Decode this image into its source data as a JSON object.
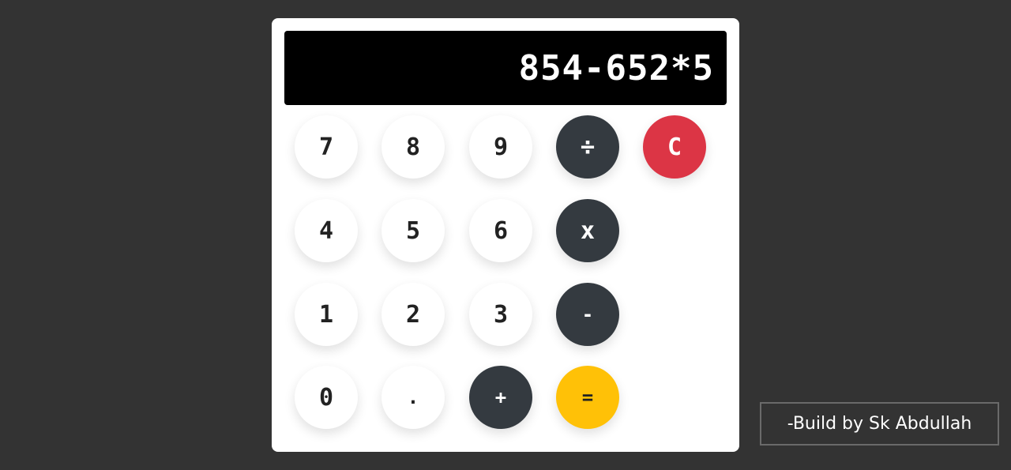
{
  "display": {
    "value": "854-652*5"
  },
  "keys": {
    "k7": "7",
    "k8": "8",
    "k9": "9",
    "divide": "÷",
    "clear": "C",
    "k4": "4",
    "k5": "5",
    "k6": "6",
    "multiply": "x",
    "k1": "1",
    "k2": "2",
    "k3": "3",
    "minus": "-",
    "k0": "0",
    "dot": ".",
    "plus": "+",
    "equals": "="
  },
  "credit": "-Build by Sk Abdullah",
  "colors": {
    "page_background": "#333333",
    "calculator_background": "#ffffff",
    "display_background": "#000000",
    "operator_key": "#343a40",
    "clear_key": "#dc3545",
    "equals_key": "#ffc107"
  }
}
